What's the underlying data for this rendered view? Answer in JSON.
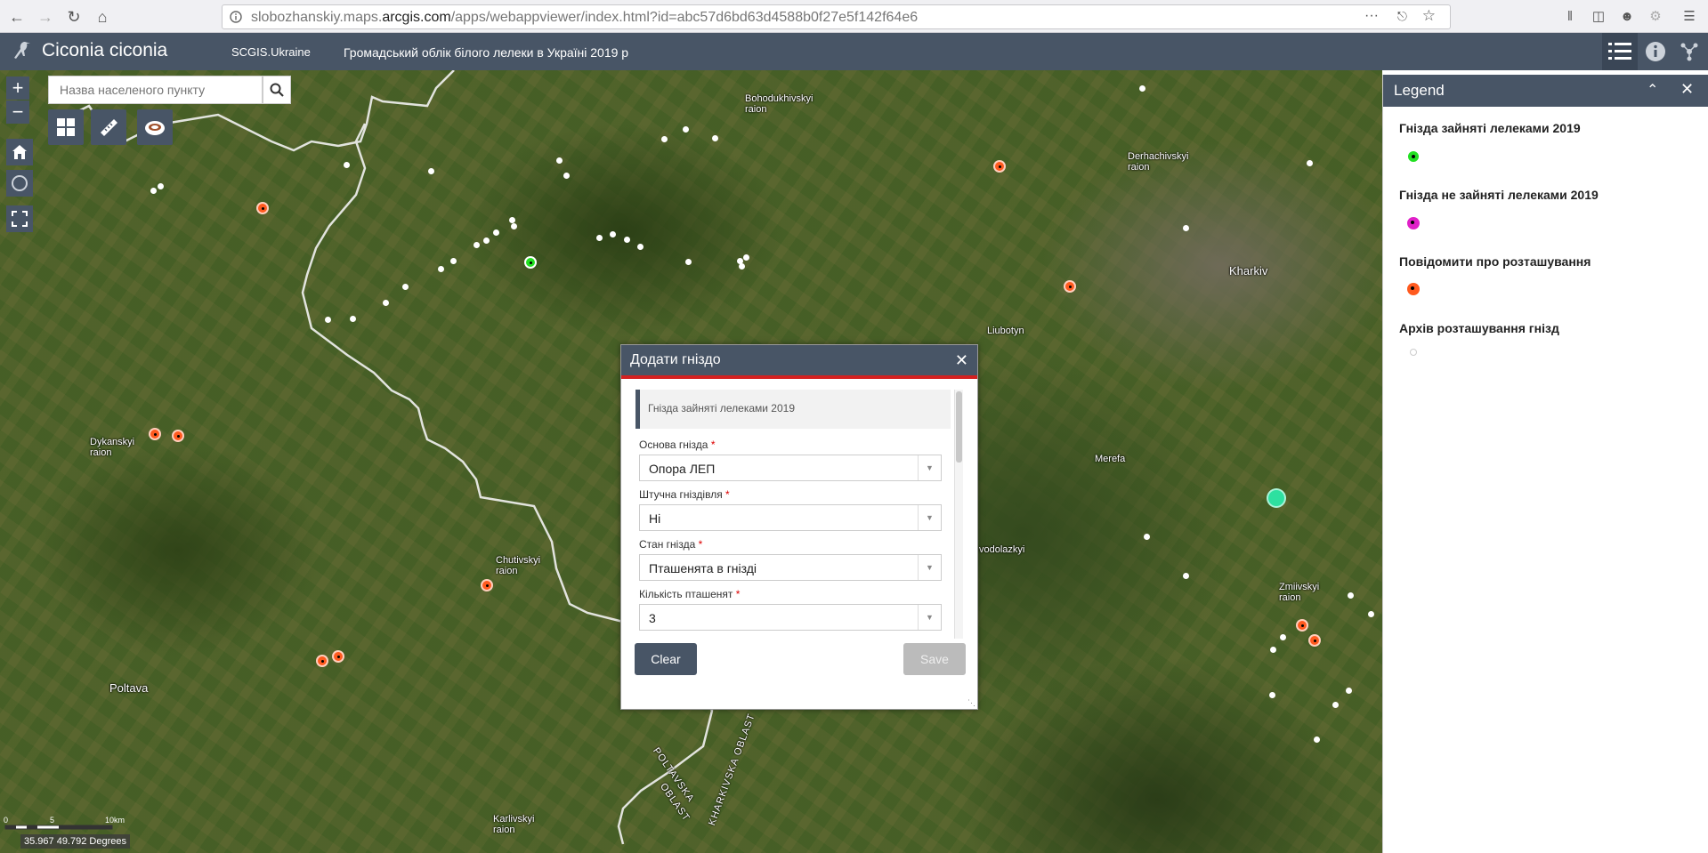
{
  "browser": {
    "url_prefix": "slobozhanskiy.maps.",
    "url_domain": "arcgis.com",
    "url_path": "/apps/webappviewer/index.html?id=abc57d6bd63d4588b0f27e5f142f64e6"
  },
  "app": {
    "title": "Ciconia ciconia",
    "subtitle": "SCGIS.Ukraine",
    "subtitle2": "Громадський облік білого лелеки в Україні 2019 р"
  },
  "search": {
    "placeholder": "Назва населеного пункту"
  },
  "map": {
    "places": [
      "Bohodukhivskyi",
      "raion",
      "Derhachivskyi",
      "raion",
      "Kharkiv",
      "Liubotyn",
      "Merefa",
      "Dykanskyi",
      "raion",
      "Chutivskyi",
      "raion",
      "Poltava",
      "Zmiivskyi",
      "raion",
      "Karlivskyi",
      "raion",
      "vodolazkyi",
      "POLTAVSKA",
      "OBLAST",
      "KHARKIVSKA OBLAST"
    ],
    "scale_labels": [
      "0",
      "5",
      "10km"
    ],
    "coords": "35.967 49.792 Degrees"
  },
  "legend": {
    "title": "Legend",
    "items": [
      {
        "label": "Гнізда зайняті лелеками 2019",
        "color": "#22e022"
      },
      {
        "label": "Гнізда не зайняті лелеками 2019",
        "color": "#e020c8"
      },
      {
        "label": "Повідомити про розташування",
        "color": "#ff5a1f"
      },
      {
        "label": "Архів розташування гнізд",
        "color": "#ffffff"
      }
    ]
  },
  "dialog": {
    "title": "Додати гніздо",
    "layer_name": "Гнізда зайняті лелеками 2019",
    "fields": [
      {
        "label": "Основа гнізда",
        "value": "Опора ЛЕП"
      },
      {
        "label": "Штучна гніздівля",
        "value": "Ні"
      },
      {
        "label": "Стан гнізда",
        "value": "Пташенята в гнізді"
      },
      {
        "label": "Кількість пташенят",
        "value": "3"
      }
    ],
    "required_mark": "*",
    "clear_label": "Clear",
    "save_label": "Save"
  }
}
